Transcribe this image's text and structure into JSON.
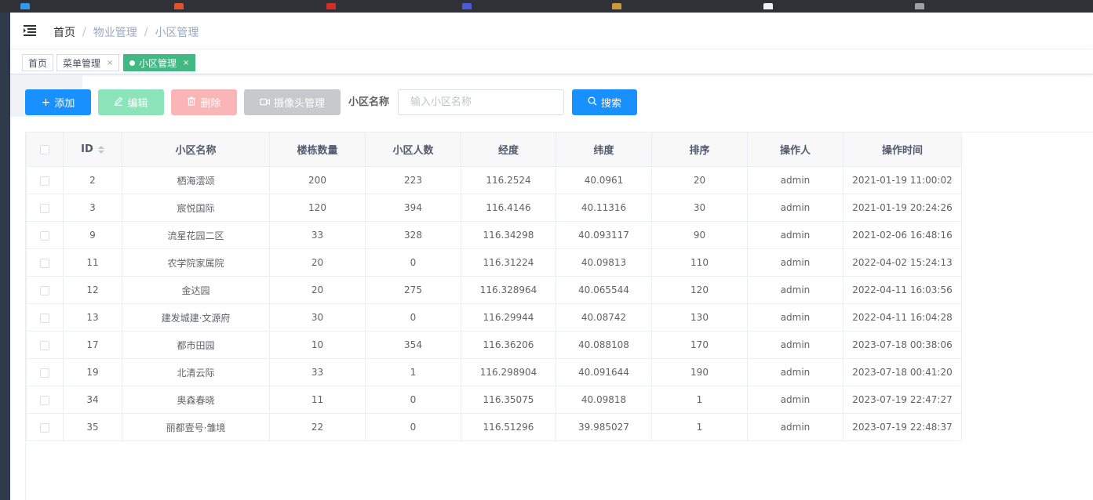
{
  "breadcrumb": [
    "首页",
    "物业管理",
    "小区管理"
  ],
  "tabs": [
    {
      "label": "首页",
      "closable": false
    },
    {
      "label": "菜单管理",
      "closable": true
    },
    {
      "label": "小区管理",
      "closable": true,
      "active": true
    }
  ],
  "toolbar": {
    "add_label": "添加",
    "edit_label": "编辑",
    "delete_label": "删除",
    "camera_label": "摄像头管理",
    "search_label": "小区名称",
    "search_placeholder": "输入小区名称",
    "search_button_label": "搜索"
  },
  "table": {
    "columns": [
      "ID",
      "小区名称",
      "楼栋数量",
      "小区人数",
      "经度",
      "纬度",
      "排序",
      "操作人",
      "操作时间"
    ],
    "rows": [
      [
        "2",
        "栖海澐颂",
        "200",
        "223",
        "116.2524",
        "40.0961",
        "20",
        "admin",
        "2021-01-19 11:00:02"
      ],
      [
        "3",
        "宸悦国际",
        "120",
        "394",
        "116.4146",
        "40.11316",
        "30",
        "admin",
        "2021-01-19 20:24:26"
      ],
      [
        "9",
        "流星花园二区",
        "33",
        "328",
        "116.34298",
        "40.093117",
        "90",
        "admin",
        "2021-02-06 16:48:16"
      ],
      [
        "11",
        "农学院家属院",
        "20",
        "0",
        "116.31224",
        "40.09813",
        "110",
        "admin",
        "2022-04-02 15:24:13"
      ],
      [
        "12",
        "金达园",
        "20",
        "275",
        "116.328964",
        "40.065544",
        "120",
        "admin",
        "2022-04-11 16:03:56"
      ],
      [
        "13",
        "建发城建·文源府",
        "30",
        "0",
        "116.29944",
        "40.08742",
        "130",
        "admin",
        "2022-04-11 16:04:28"
      ],
      [
        "17",
        "都市田园",
        "10",
        "354",
        "116.36206",
        "40.088108",
        "170",
        "admin",
        "2023-07-18 00:38:06"
      ],
      [
        "19",
        "北清云际",
        "33",
        "1",
        "116.298904",
        "40.091644",
        "190",
        "admin",
        "2023-07-18 00:41:20"
      ],
      [
        "34",
        "奥森春晓",
        "11",
        "0",
        "116.35075",
        "40.09818",
        "1",
        "admin",
        "2023-07-19 22:47:27"
      ],
      [
        "35",
        "丽都壹号·雏境",
        "22",
        "0",
        "116.51296",
        "39.985027",
        "1",
        "admin",
        "2023-07-19 22:48:37"
      ]
    ]
  },
  "colors": {
    "primary": "#1890ff",
    "active_tag": "#42b983",
    "edit_disabled": "#8ce4ba",
    "delete_disabled": "#fab6b6",
    "camera_disabled": "#c8c9cc",
    "sidebar": "#2f3a4b"
  },
  "icons": {
    "menu_toggle": "hamburger-icon",
    "add": "plus-icon",
    "edit": "edit-icon",
    "delete": "trash-icon",
    "camera": "video-camera-icon",
    "search": "search-icon",
    "sort": "sort-caret-icon"
  }
}
